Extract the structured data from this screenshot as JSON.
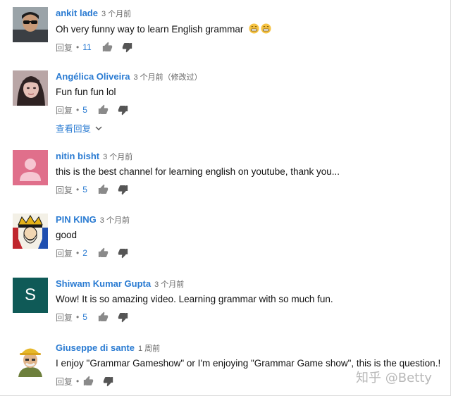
{
  "comments": [
    {
      "author": "ankit lade",
      "time": "3 个月前",
      "text": "Oh very funny way to learn English grammar",
      "reply": "回复",
      "dot": "•",
      "likes": "11",
      "emoji": [
        "grinning-face",
        "grinning-face"
      ],
      "avatar": "avatar-man-sunglasses"
    },
    {
      "author": "Angélica Oliveira",
      "time": "3 个月前（修改过）",
      "text": "Fun fun fun lol",
      "reply": "回复",
      "dot": "•",
      "likes": "5",
      "view_replies": "查看回复",
      "avatar": "avatar-woman-photo"
    },
    {
      "author": "nitin bisht",
      "time": "3 个月前",
      "text": "this is the best channel for learning english  on youtube, thank you...",
      "reply": "回复",
      "dot": "•",
      "likes": "5",
      "avatar": "avatar-default-pink"
    },
    {
      "author": "PIN KING",
      "time": "3 个月前",
      "text": "good",
      "reply": "回复",
      "dot": "•",
      "likes": "2",
      "avatar": "avatar-king-card"
    },
    {
      "author": "Shiwam Kumar Gupta",
      "time": "3 个月前",
      "text": "Wow! It is so amazing video. Learning grammar with so much fun.",
      "reply": "回复",
      "dot": "•",
      "likes": "5",
      "avatar_letter": "S",
      "avatar": "avatar-letter-teal"
    },
    {
      "author": "Giuseppe di sante",
      "time": "1 周前",
      "text": "I enjoy \"Grammar Gameshow\" or I'm enjoying \"Grammar Game show\", this is the question.!",
      "reply": "回复",
      "dot": "•",
      "likes": "",
      "avatar": "avatar-man-hat"
    }
  ],
  "watermark": "知乎 @Betty",
  "colors": {
    "link": "#2a7bd2",
    "muted": "#7a7a7a",
    "teal_avatar": "#0f5a57",
    "pink_avatar": "#e06f8b"
  }
}
